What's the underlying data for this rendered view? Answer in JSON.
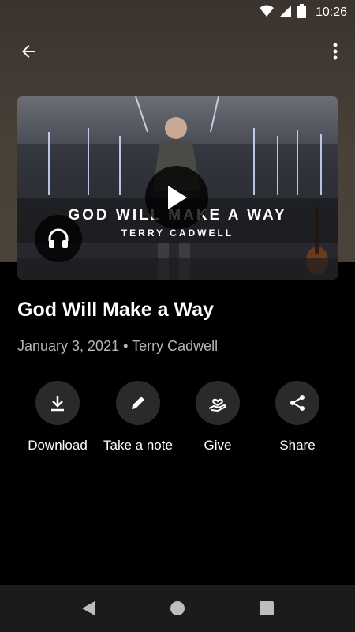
{
  "status_bar": {
    "time": "10:26"
  },
  "video": {
    "banner_title": "GOD WILL MAKE A WAY",
    "banner_speaker": "TERRY CADWELL"
  },
  "sermon": {
    "title": "God Will Make a Way",
    "meta": "January 3, 2021 • Terry Cadwell"
  },
  "actions": [
    {
      "label": "Download",
      "icon": "download-icon"
    },
    {
      "label": "Take a note",
      "icon": "pencil-icon"
    },
    {
      "label": "Give",
      "icon": "give-heart-hand-icon"
    },
    {
      "label": "Share",
      "icon": "share-icon"
    }
  ],
  "colors": {
    "background": "#000000",
    "header": "#4a4138",
    "action_circle": "#2a2a2a",
    "meta_text": "#b5b5b5"
  }
}
